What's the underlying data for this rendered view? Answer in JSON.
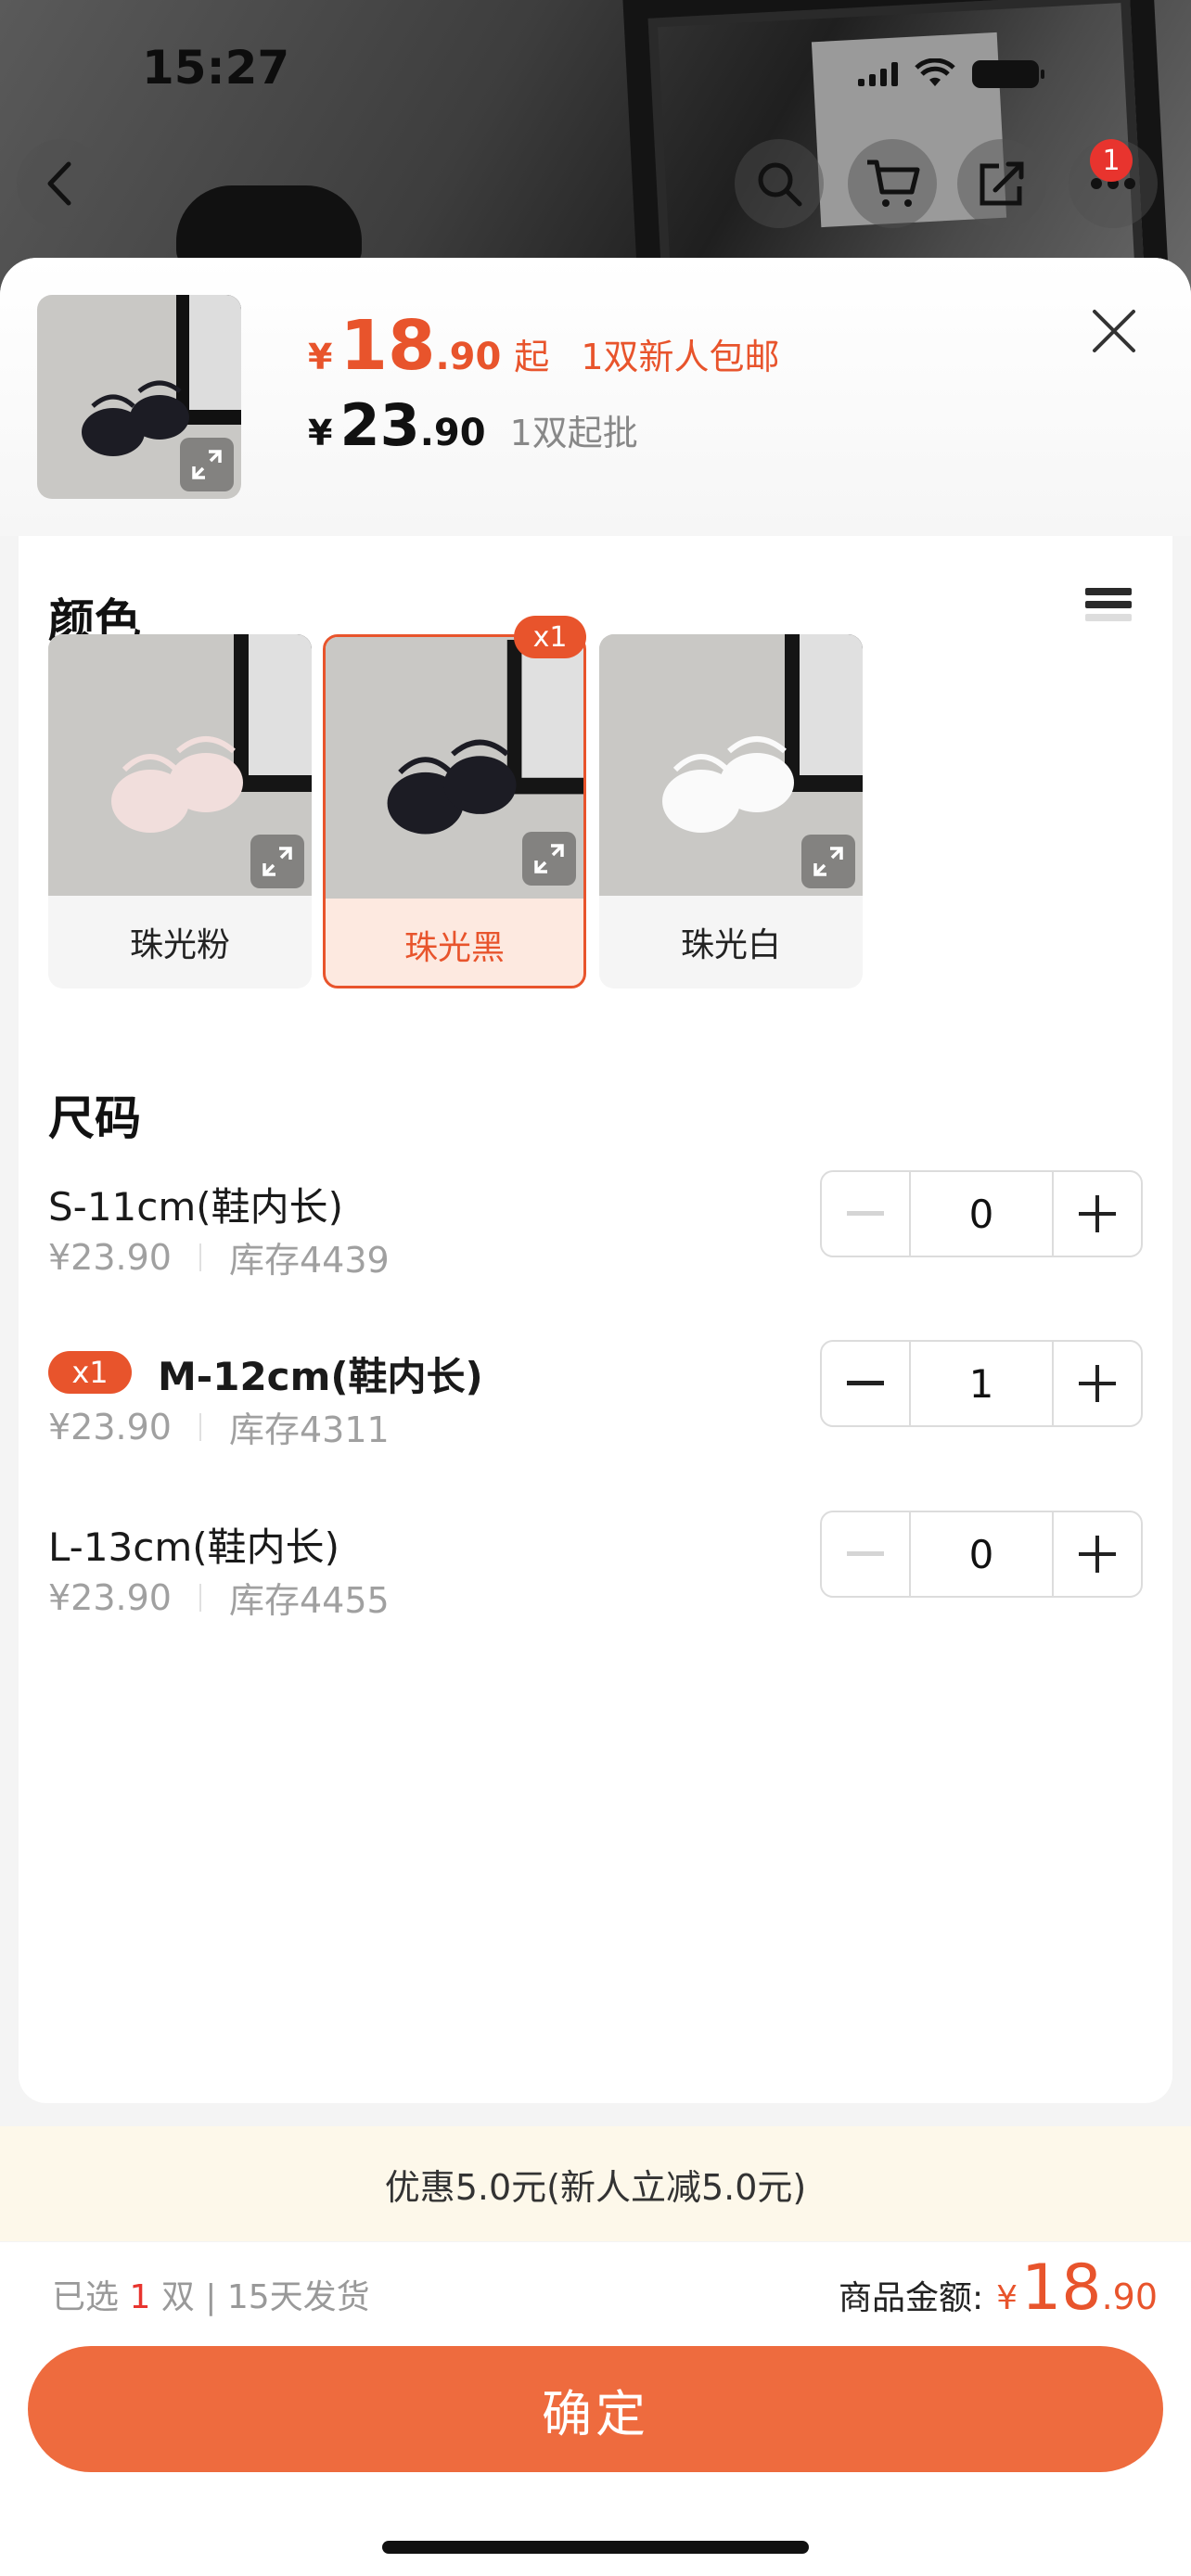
{
  "status_bar": {
    "time": "15:27"
  },
  "top_bar": {
    "cart_badge": "1"
  },
  "header": {
    "price_symbol": "¥",
    "price_int": "18",
    "price_dec": ".90",
    "price_suffix": "起",
    "promo": "1双新人包邮",
    "orig_symbol": "¥",
    "orig_int": "23",
    "orig_dec": ".90",
    "min_batch": "1双起批"
  },
  "color_section": {
    "title": "颜色",
    "selected_badge": "x1",
    "options": [
      {
        "label": "珠光粉",
        "shoe_color": "#f1dedc",
        "selected": false
      },
      {
        "label": "珠光黑",
        "shoe_color": "#1c1c24",
        "selected": true
      },
      {
        "label": "珠光白",
        "shoe_color": "#fafafa",
        "selected": false
      }
    ]
  },
  "size_section": {
    "title": "尺码",
    "rows": [
      {
        "name": "S-11cm(鞋内长)",
        "price": "¥23.90",
        "stock": "库存4439",
        "qty": "0",
        "badge": ""
      },
      {
        "name": "M-12cm(鞋内长)",
        "price": "¥23.90",
        "stock": "库存4311",
        "qty": "1",
        "badge": "x1"
      },
      {
        "name": "L-13cm(鞋内长)",
        "price": "¥23.90",
        "stock": "库存4455",
        "qty": "0",
        "badge": ""
      }
    ]
  },
  "discount": {
    "text": "优惠5.0元(新人立减5.0元)"
  },
  "summary": {
    "selected_prefix": "已选",
    "selected_count": "1",
    "selected_suffix": "双 | 15天发货",
    "amount_label": "商品金额:",
    "amount_symbol": "¥",
    "amount_int": "18",
    "amount_dec": ".90"
  },
  "confirm_label": "确定",
  "colors": {
    "accent": "#e8542c",
    "button": "#ee6b3e",
    "badge_red": "#e8342e"
  }
}
